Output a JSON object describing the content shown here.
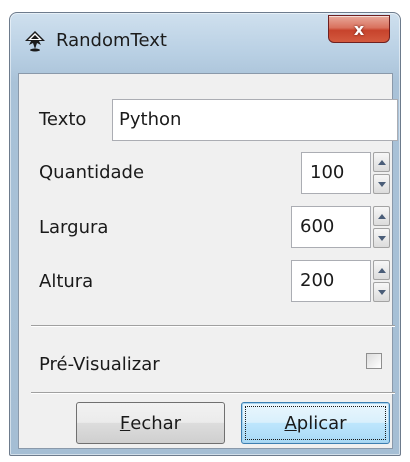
{
  "window": {
    "title": "RandomText",
    "close_glyph": "x",
    "icon": "inkscape-icon"
  },
  "form": {
    "texto_label": "Texto",
    "texto_value": "Python",
    "quantidade_label": "Quantidade",
    "quantidade_value": "100",
    "largura_label": "Largura",
    "largura_value": "600",
    "altura_label": "Altura",
    "altura_value": "200",
    "preview_label": "Pré-Visualizar",
    "preview_checked": false
  },
  "buttons": {
    "fechar_mnemonic": "F",
    "fechar_rest": "echar",
    "aplicar_mnemonic": "A",
    "aplicar_rest": "plicar"
  },
  "colors": {
    "titlebar": "#b9d0e4",
    "close_button": "#c7432c",
    "dialog_bg": "#f0f0f0",
    "default_button": "#bee6fd"
  }
}
